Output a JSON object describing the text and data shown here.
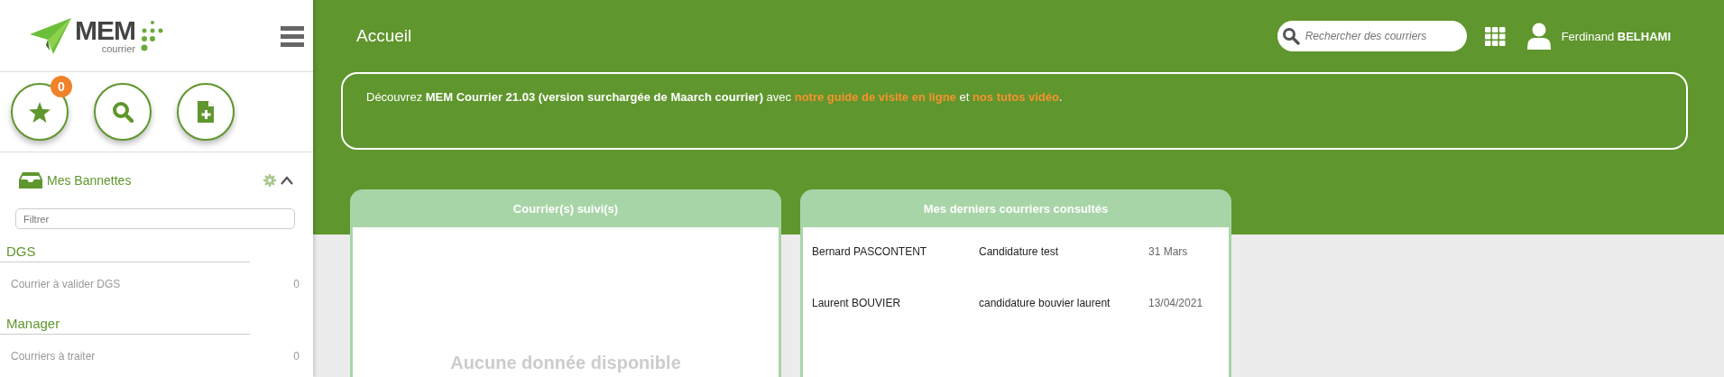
{
  "logo": {
    "title": "MEM",
    "subtitle": "courrier"
  },
  "quick_actions": [
    {
      "kind": "favorites",
      "badge": "0"
    },
    {
      "kind": "search"
    },
    {
      "kind": "new-document"
    }
  ],
  "bannettes": {
    "title": "Mes Bannettes",
    "expanded": true,
    "filter_placeholder": "Filtrer",
    "groups": [
      {
        "name": "DGS",
        "items": [
          {
            "label": "Courrier à valider DGS",
            "count": "0"
          }
        ]
      },
      {
        "name": "Manager",
        "items": [
          {
            "label": "Courriers à traiter",
            "count": "0"
          }
        ]
      }
    ]
  },
  "header": {
    "title": "Accueil",
    "search_placeholder": "Rechercher des courriers",
    "user": "Ferdinand **BELHAMI**"
  },
  "banner": [
    {
      "kind": "text",
      "text": "Découvrez **MEM Courrier 21.03 (version surchargée de Maarch courrier)** avec "
    },
    {
      "kind": "link",
      "text": "notre guide de visite en ligne"
    },
    {
      "kind": "text",
      "text": " et "
    },
    {
      "kind": "link",
      "text": "nos tutos vidéo"
    },
    {
      "kind": "text",
      "text": "."
    }
  ],
  "followed_card": {
    "title": "Courrier(s) suivi(s)",
    "empty_message": "Aucune donnée disponible"
  },
  "recent_card": {
    "title": "Mes derniers courriers consultés",
    "rows": [
      {
        "contact": "Bernard PASCONTENT",
        "subject": "Candidature test",
        "date": "31 Mars"
      },
      {
        "contact": "Laurent BOUVIER",
        "subject": "candidature bouvier laurent",
        "date": "13/04/2021"
      }
    ]
  }
}
